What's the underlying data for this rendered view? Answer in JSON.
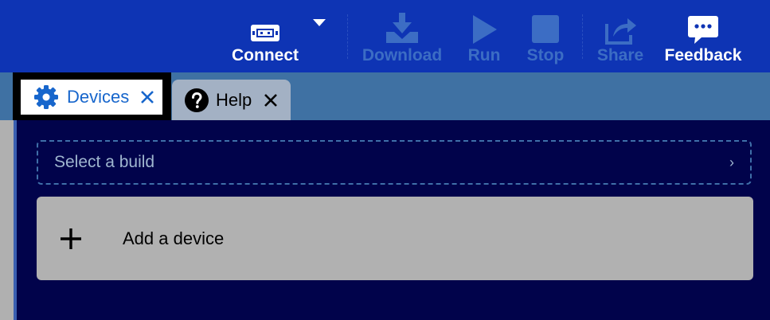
{
  "toolbar": {
    "connect_label": "Connect",
    "download_label": "Download",
    "run_label": "Run",
    "stop_label": "Stop",
    "share_label": "Share",
    "feedback_label": "Feedback",
    "icons": {
      "connect": "device-icon",
      "dropdown": "caret-down-icon",
      "download": "download-icon",
      "run": "play-icon",
      "stop": "stop-icon",
      "share": "share-icon",
      "feedback": "chat-bubble-icon"
    }
  },
  "tabs": [
    {
      "label": "Devices",
      "icon": "gear-icon",
      "close_icon": "close-icon",
      "active": true
    },
    {
      "label": "Help",
      "icon": "question-icon",
      "close_icon": "close-icon",
      "active": false
    }
  ],
  "main": {
    "select_build": {
      "label": "Select a build",
      "chevron": "›"
    },
    "add_device": {
      "label": "Add a device",
      "icon": "plus-icon"
    }
  },
  "colors": {
    "toolbar_bg": "#0e34b4",
    "disabled_text": "#3c6dc4",
    "content_bg": "#01034b",
    "tabstrip_bg": "#3f71a3",
    "active_tab_text": "#1766cc"
  }
}
